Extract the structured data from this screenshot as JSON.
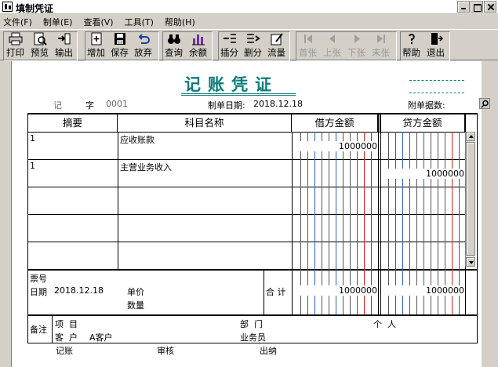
{
  "window": {
    "title": "填制凭证"
  },
  "menu": [
    "文件(F)",
    "制单(E)",
    "查看(V)",
    "工具(T)",
    "帮助(H)"
  ],
  "toolbar": {
    "print": "打印",
    "preview": "预览",
    "export": "输出",
    "add": "增加",
    "save": "保存",
    "discard": "放弃",
    "query": "查询",
    "balance": "余额",
    "insert": "插分",
    "delete": "删分",
    "flow": "流量",
    "first": "首张",
    "prev": "上张",
    "next": "下张",
    "last": "末张",
    "help": "帮助",
    "exit": "退出"
  },
  "voucher": {
    "title": "记账凭证",
    "type_label": "记",
    "no_label": "字",
    "no": "0001",
    "date_label": "制单日期:",
    "date": "2018.12.18",
    "attach_label": "附单据数:",
    "col_summary": "摘要",
    "col_account": "科目名称",
    "col_debit": "借方金额",
    "col_credit": "贷方金额",
    "rows": [
      {
        "summary": "1",
        "account": "应收账款",
        "debit": "1000000",
        "credit": ""
      },
      {
        "summary": "1",
        "account": "主营业务收入",
        "debit": "",
        "credit": "1000000"
      }
    ],
    "ticket_label": "票号",
    "date_label2": "日期",
    "date2": "2018.12.18",
    "price_label": "单价",
    "qty_label": "数量",
    "total_label": "合 计",
    "total_debit": "1000000",
    "total_credit": "1000000",
    "note_label": "备注",
    "project_label": "项  目",
    "customer_label": "客  户",
    "customer": "A客户",
    "dept_label": "部  门",
    "person_label": "个  人",
    "clerk_label": "业务员",
    "bookkeep_label": "记账",
    "audit_label": "审核",
    "cashier_label": "出纳"
  }
}
